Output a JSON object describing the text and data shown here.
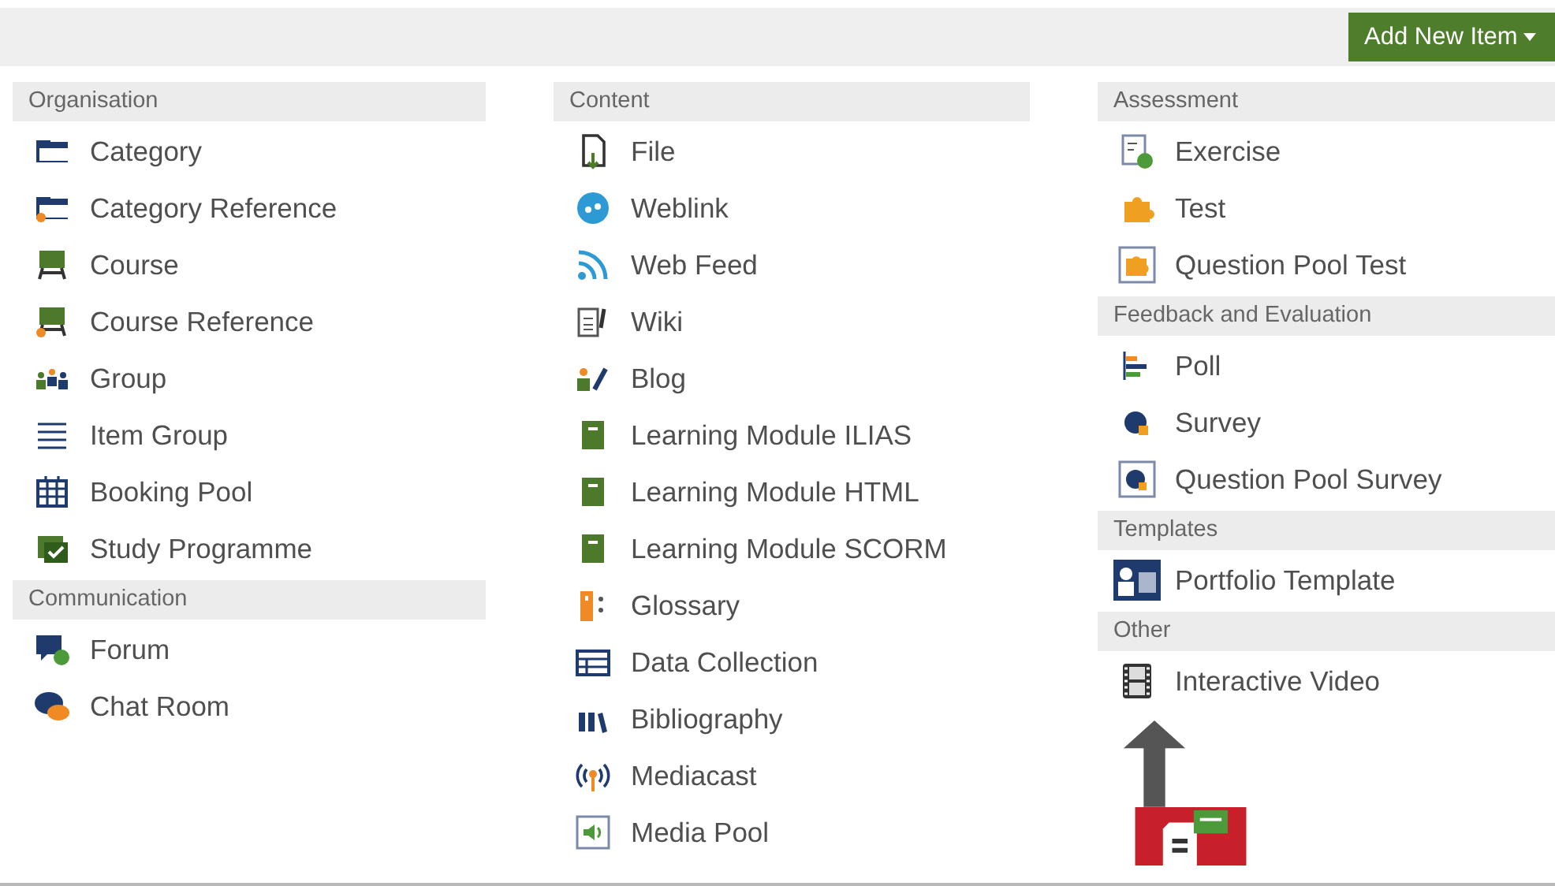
{
  "toolbar": {
    "button": {
      "label": "Add New Item"
    }
  },
  "columns": [
    {
      "sections": [
        {
          "title": "Organisation",
          "items": [
            {
              "label": "Category",
              "kind": "category"
            },
            {
              "label": "Category Reference",
              "kind": "category-ref"
            },
            {
              "label": "Course",
              "kind": "course"
            },
            {
              "label": "Course Reference",
              "kind": "course-ref"
            },
            {
              "label": "Group",
              "kind": "group"
            },
            {
              "label": "Item Group",
              "kind": "itemgroup"
            },
            {
              "label": "Booking Pool",
              "kind": "booking"
            },
            {
              "label": "Study Programme",
              "kind": "study"
            }
          ]
        },
        {
          "title": "Communication",
          "items": [
            {
              "label": "Forum",
              "kind": "forum"
            },
            {
              "label": "Chat Room",
              "kind": "chat"
            }
          ]
        }
      ]
    },
    {
      "sections": [
        {
          "title": "Content",
          "items": [
            {
              "label": "File",
              "kind": "file"
            },
            {
              "label": "Weblink",
              "kind": "weblink"
            },
            {
              "label": "Web Feed",
              "kind": "feed"
            },
            {
              "label": "Wiki",
              "kind": "wiki"
            },
            {
              "label": "Blog",
              "kind": "blog"
            },
            {
              "label": "Learning Module ILIAS",
              "kind": "module"
            },
            {
              "label": "Learning Module HTML",
              "kind": "module"
            },
            {
              "label": "Learning Module SCORM",
              "kind": "module"
            },
            {
              "label": "Glossary",
              "kind": "glossary"
            },
            {
              "label": "Data Collection",
              "kind": "table"
            },
            {
              "label": "Bibliography",
              "kind": "biblio"
            },
            {
              "label": "Mediacast",
              "kind": "mediacast"
            },
            {
              "label": "Media Pool",
              "kind": "mediapool"
            }
          ]
        }
      ]
    },
    {
      "sections": [
        {
          "title": "Assessment",
          "items": [
            {
              "label": "Exercise",
              "kind": "exercise"
            },
            {
              "label": "Test",
              "kind": "test"
            },
            {
              "label": "Question Pool Test",
              "kind": "testpool"
            }
          ]
        },
        {
          "title": "Feedback and Evaluation",
          "items": [
            {
              "label": "Poll",
              "kind": "poll"
            },
            {
              "label": "Survey",
              "kind": "survey"
            },
            {
              "label": "Question Pool Survey",
              "kind": "surveypool"
            }
          ]
        },
        {
          "title": "Templates",
          "items": [
            {
              "label": "Portfolio Template",
              "kind": "portfolio"
            }
          ]
        },
        {
          "title": "Other",
          "items": [
            {
              "label": "Interactive Video",
              "kind": "video"
            }
          ]
        }
      ]
    }
  ]
}
